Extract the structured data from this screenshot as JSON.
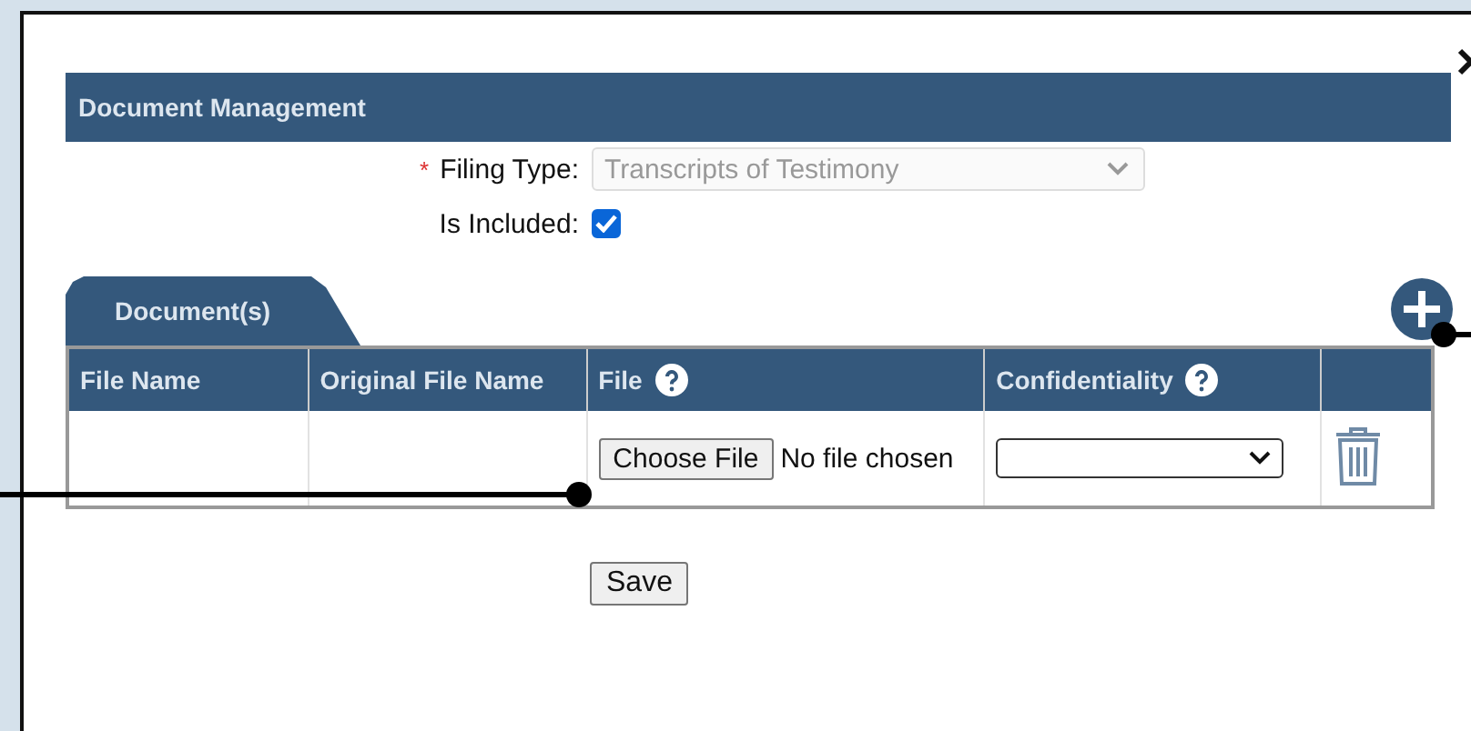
{
  "panel": {
    "title": "Document Management"
  },
  "form": {
    "filing_type": {
      "label": "Filing Type:",
      "required_mark": "*",
      "value": "Transcripts of Testimony",
      "disabled": true
    },
    "is_included": {
      "label": "Is Included:",
      "checked": true
    }
  },
  "tabs": [
    {
      "label": "Document(s)",
      "selected": true
    }
  ],
  "table": {
    "columns": [
      {
        "label": "File Name",
        "help": false
      },
      {
        "label": "Original File Name",
        "help": false
      },
      {
        "label": "File",
        "help": true
      },
      {
        "label": "Confidentiality",
        "help": true
      },
      {
        "help": false
      }
    ],
    "rows": [
      {
        "file_button": "Choose File",
        "file_status": "No file chosen"
      }
    ]
  },
  "buttons": [
    {
      "label": "Save"
    }
  ]
}
